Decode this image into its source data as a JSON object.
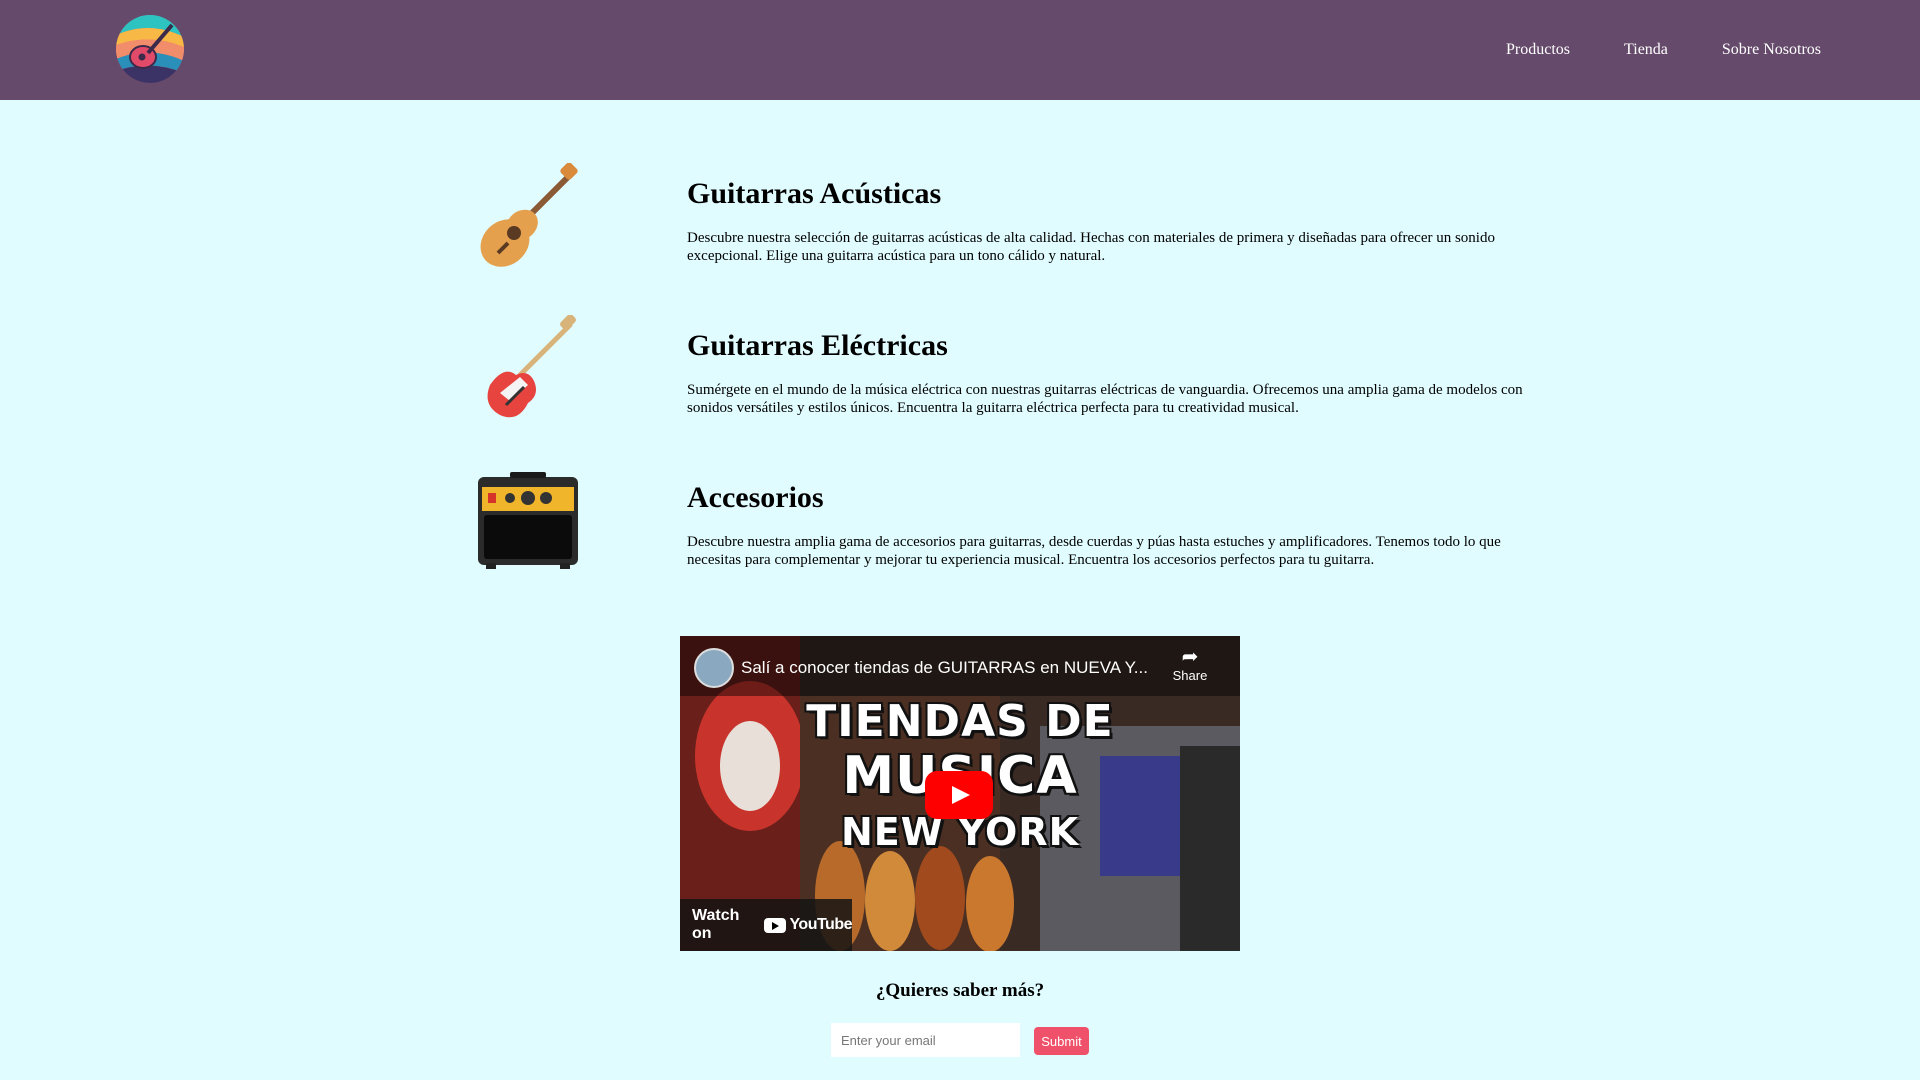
{
  "nav": {
    "items": [
      {
        "label": "Productos"
      },
      {
        "label": "Tienda"
      },
      {
        "label": "Sobre Nosotros"
      }
    ]
  },
  "products": [
    {
      "title": "Guitarras Acústicas",
      "description": "Descubre nuestra selección de guitarras acústicas de alta calidad. Hechas con materiales de primera y diseñadas para ofrecer un sonido excepcional. Elige una guitarra acústica para un tono cálido y natural.",
      "icon": "acoustic-guitar-icon"
    },
    {
      "title": "Guitarras Eléctricas",
      "description": "Sumérgete en el mundo de la música eléctrica con nuestras guitarras eléctricas de vanguardia. Ofrecemos una amplia gama de modelos con sonidos versátiles y estilos únicos. Encuentra la guitarra eléctrica perfecta para tu creatividad musical.",
      "icon": "electric-guitar-icon"
    },
    {
      "title": "Accesorios",
      "description": "Descubre nuestra amplia gama de accesorios para guitarras, desde cuerdas y púas hasta estuches y amplificadores. Tenemos todo lo que necesitas para complementar y mejorar tu experiencia musical. Encuentra los accesorios perfectos para tu guitarra.",
      "icon": "amplifier-icon"
    }
  ],
  "video": {
    "title": "Salí a conocer tiendas de GUITARRAS en NUEVA Y...",
    "share_label": "Share",
    "thumb_line1": "TIENDAS DE",
    "thumb_line2": "MUSICA",
    "thumb_line3": "NEW YORK",
    "watch_label": "Watch on",
    "yt_label": "YouTube"
  },
  "newsletter": {
    "heading": "¿Quieres saber más?",
    "placeholder": "Enter your email",
    "submit_label": "Submit"
  },
  "colors": {
    "header": "#654a6b",
    "background": "#e0fcff",
    "submit": "#f0516a"
  }
}
